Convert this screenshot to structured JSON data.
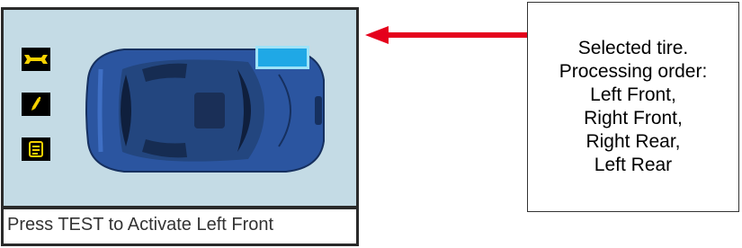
{
  "device": {
    "status_text": "Press TEST to Activate Left Front",
    "menu_icons": [
      {
        "name": "wrench-icon",
        "color": "#f7d200"
      },
      {
        "name": "pencil-icon",
        "color": "#f7d200"
      },
      {
        "name": "document-icon",
        "color": "#f7d200"
      }
    ],
    "highlight_color": "#1fa8e6",
    "car_color": "#2b55a0"
  },
  "callout": {
    "lines": [
      "Selected tire.",
      "Processing order:",
      "Left Front,",
      "Right Front,",
      "Right Rear,",
      "Left Rear"
    ]
  },
  "arrow_color": "#e5001c"
}
